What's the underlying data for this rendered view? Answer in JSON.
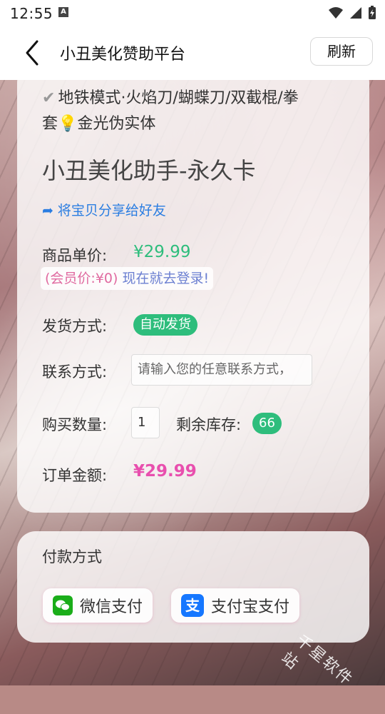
{
  "status_bar": {
    "time": "12:55",
    "notification_icon": "A"
  },
  "header": {
    "title": "小丑美化赞助平台",
    "refresh_label": "刷新"
  },
  "product": {
    "description_line1": "地铁模式·火焰刀/蝴蝶刀/双截棍/拳",
    "description_line2_pre": "套",
    "description_line2_post": "金光伪实体",
    "name": "小丑美化助手-永久卡",
    "share_label": "将宝贝分享给好友",
    "unit_price_label": "商品单价:",
    "unit_price": "¥29.99",
    "member_price": "(会员价:¥0)",
    "login_link": "现在就去登录!",
    "delivery_label": "发货方式:",
    "delivery_value": "自动发货",
    "contact_label": "联系方式:",
    "contact_placeholder": "请输入您的任意联系方式，",
    "quantity_label": "购买数量:",
    "quantity_value": "1",
    "stock_label": "剩余库存:",
    "stock_value": "66",
    "total_label": "订单金额:",
    "total_value": "¥29.99"
  },
  "payment": {
    "title": "付款方式",
    "wechat_label": "微信支付",
    "alipay_label": "支付宝支付",
    "alipay_icon_char": "支"
  },
  "watermark": "千星软件站",
  "colors": {
    "green": "#2ebd7c",
    "pink": "#e84fae",
    "blue": "#2a7de1"
  }
}
